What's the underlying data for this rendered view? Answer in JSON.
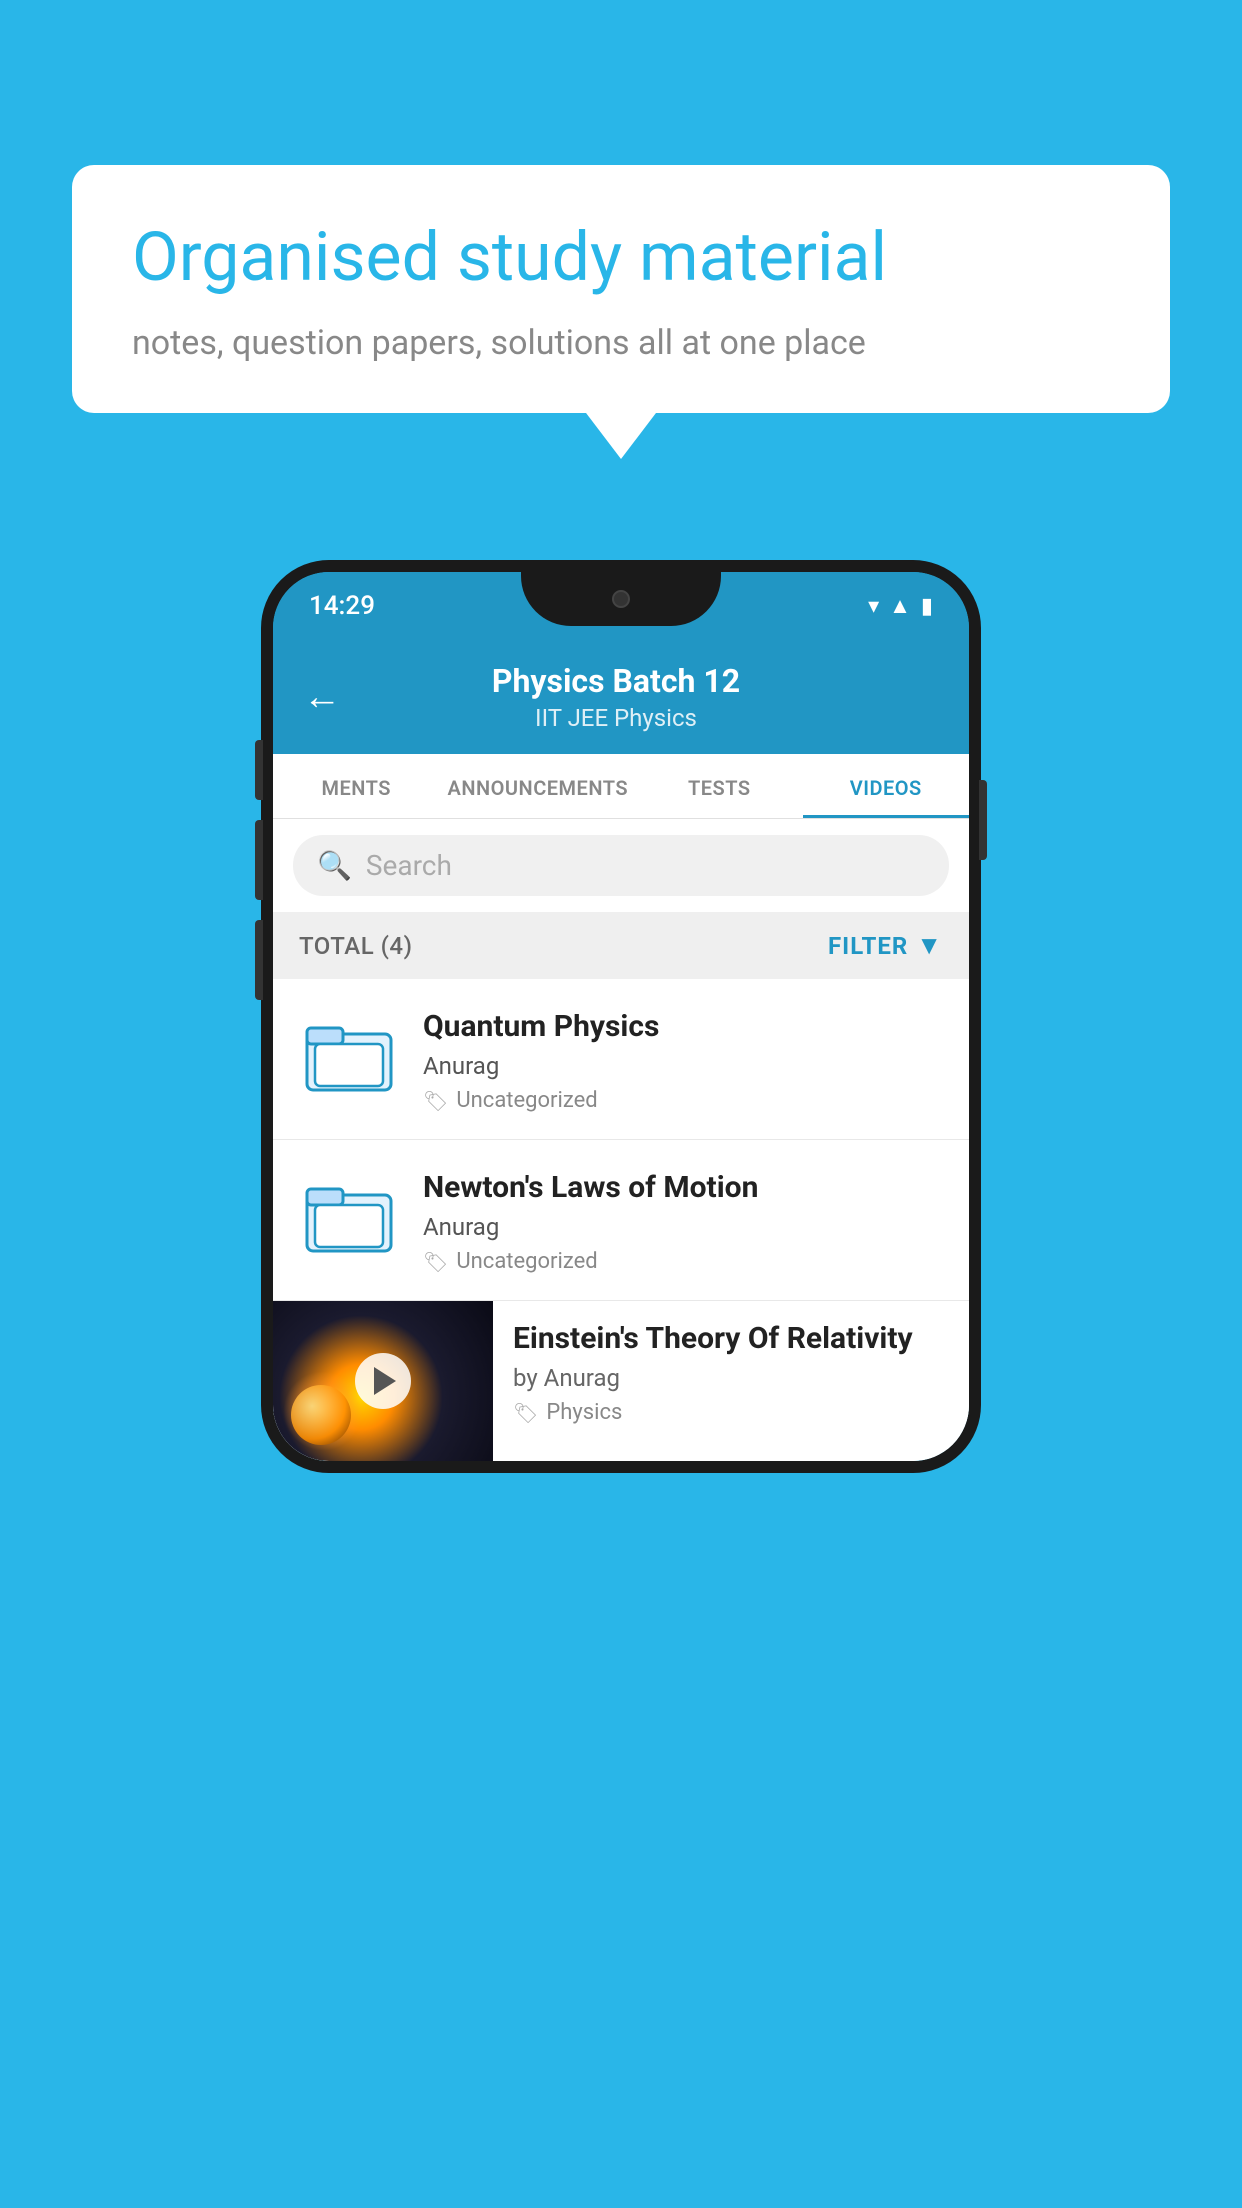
{
  "background_color": "#29b6e8",
  "speech_bubble": {
    "headline": "Organised study material",
    "subtext": "notes, question papers, solutions all at one place"
  },
  "phone": {
    "status_bar": {
      "time": "14:29",
      "icons": [
        "wifi",
        "signal",
        "battery"
      ]
    },
    "app_header": {
      "back_label": "←",
      "title": "Physics Batch 12",
      "subtitle": "IIT JEE   Physics"
    },
    "tabs": [
      {
        "label": "MENTS",
        "active": false
      },
      {
        "label": "ANNOUNCEMENTS",
        "active": false
      },
      {
        "label": "TESTS",
        "active": false
      },
      {
        "label": "VIDEOS",
        "active": true
      }
    ],
    "search": {
      "placeholder": "Search"
    },
    "filter_bar": {
      "total_label": "TOTAL (4)",
      "filter_label": "FILTER"
    },
    "videos": [
      {
        "title": "Quantum Physics",
        "author": "Anurag",
        "tag": "Uncategorized",
        "type": "folder"
      },
      {
        "title": "Newton's Laws of Motion",
        "author": "Anurag",
        "tag": "Uncategorized",
        "type": "folder"
      },
      {
        "title": "Einstein's Theory Of Relativity",
        "author": "by Anurag",
        "tag": "Physics",
        "type": "video"
      }
    ]
  }
}
